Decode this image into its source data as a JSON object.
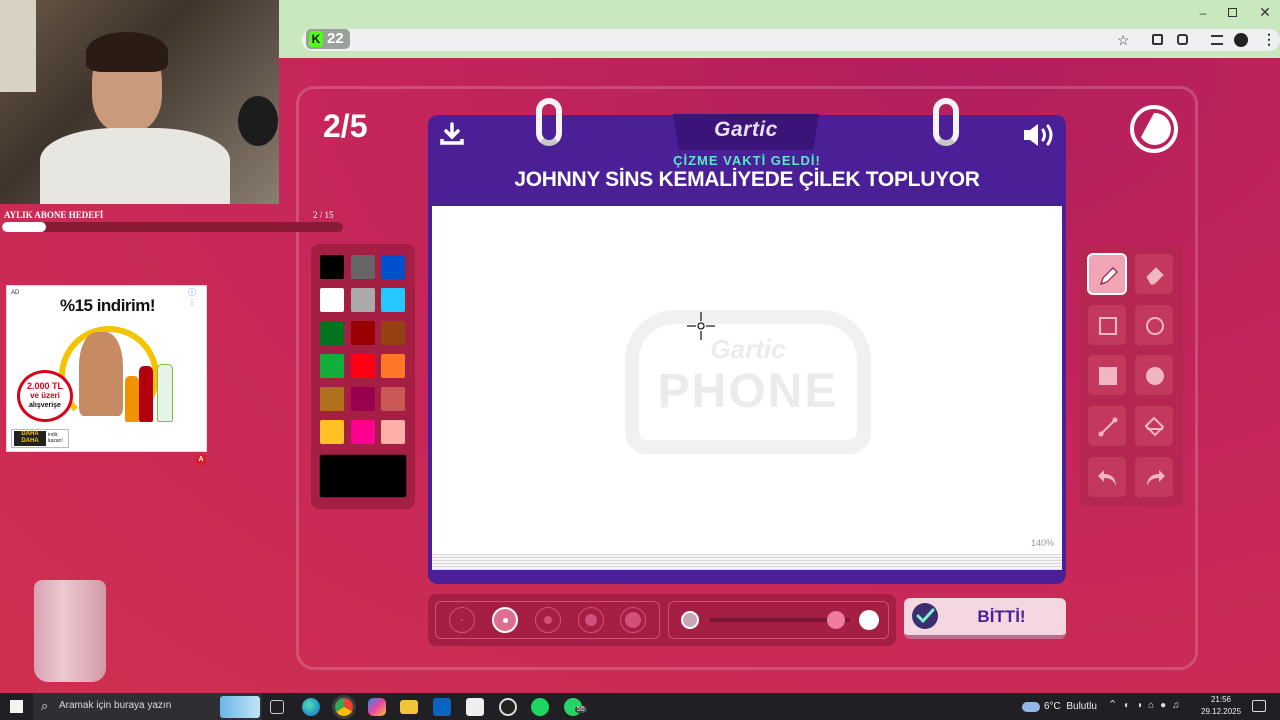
{
  "browser": {
    "tab_badge": "22",
    "window_controls": [
      "minimize-icon",
      "restore-icon",
      "close-icon"
    ]
  },
  "stream": {
    "goal_label": "AYLIK ABONE HEDEFİ",
    "goal_count": "2 / 15",
    "goal_progress": 0.13,
    "ad": {
      "ad_tag": "AD",
      "headline": "%15 indirim!",
      "badge_line1": "2.000 TL",
      "badge_line2": "ve üzeri",
      "badge_line3": "alışverişe",
      "logo_top": "DAHA",
      "logo_bottom": "DAHA",
      "logo_side_1": "indir,",
      "logo_side_2": "kazan!",
      "corner": "A"
    }
  },
  "game": {
    "round": "2/5",
    "logo": "Gartic",
    "subtitle": "ÇİZME VAKTİ GELDİ!",
    "prompt": "JOHNNY SİNS KEMALİYEDE ÇİLEK TOPLUYOR",
    "zoom": "140%",
    "watermark_top": "Gartic",
    "watermark_bottom": "PHONE",
    "done_button": "BİTTİ!",
    "palette": [
      "#000000",
      "#666666",
      "#0050cd",
      "#ffffff",
      "#aaaaaa",
      "#26c9ff",
      "#017420",
      "#990000",
      "#964112",
      "#11b03c",
      "#ff0013",
      "#ff7829",
      "#b0701c",
      "#99004e",
      "#cb5a57",
      "#ffc126",
      "#ff008f",
      "#feafa8"
    ],
    "selected_color": "#000000",
    "brush_level": 0.9
  },
  "taskbar": {
    "search_placeholder": "Aramak için buraya yazın",
    "weather": "6°C  Bulutlu",
    "time": "21:56",
    "date": "29.12.2025",
    "whatsapp_badge": "55"
  }
}
